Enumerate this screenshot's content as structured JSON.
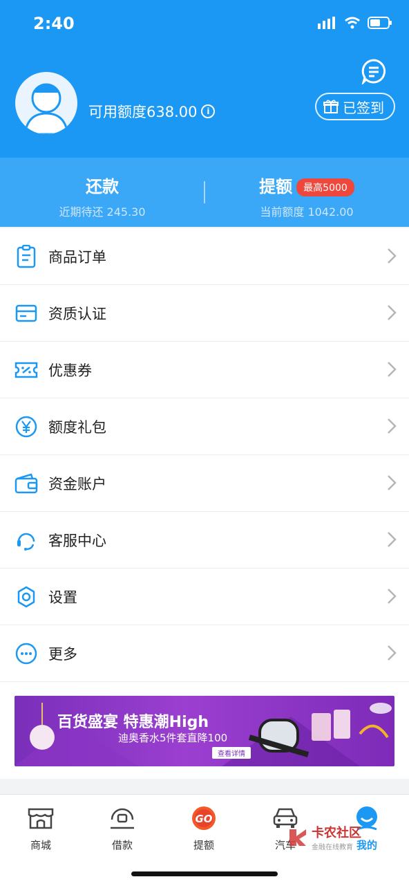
{
  "status": {
    "time": "2:40"
  },
  "header": {
    "credit_label": "可用额度638.00",
    "signin_label": "已签到"
  },
  "summary": {
    "repay": {
      "title": "还款",
      "sub": "近期待还 245.30"
    },
    "raise": {
      "title": "提额",
      "badge": "最高5000",
      "sub": "当前额度 1042.00"
    }
  },
  "menu": [
    {
      "label": "商品订单",
      "icon": "order-clipboard-icon"
    },
    {
      "label": "资质认证",
      "icon": "card-icon"
    },
    {
      "label": "优惠券",
      "icon": "coupon-icon"
    },
    {
      "label": "额度礼包",
      "icon": "yen-circle-icon"
    },
    {
      "label": "资金账户",
      "icon": "wallet-icon"
    },
    {
      "label": "客服中心",
      "icon": "headset-icon"
    },
    {
      "label": "设置",
      "icon": "gear-icon"
    },
    {
      "label": "更多",
      "icon": "more-dots-icon"
    }
  ],
  "banner": {
    "title": "百货盛宴 特惠潮High",
    "subtitle": "迪奥香水5件套直降100",
    "button": "查看详情"
  },
  "tabs": [
    {
      "label": "商城",
      "icon": "store-icon"
    },
    {
      "label": "借款",
      "icon": "loan-icon"
    },
    {
      "label": "提额",
      "icon": "go-icon"
    },
    {
      "label": "汽车",
      "icon": "car-icon"
    },
    {
      "label": "我的",
      "icon": "profile-icon",
      "active": true
    }
  ],
  "watermark": {
    "title": "卡农社区",
    "subtitle": "金融在线教育"
  },
  "colors": {
    "primary": "#1a98f3",
    "summary_bg": "#3aa8f6",
    "badge": "#f0473d"
  }
}
